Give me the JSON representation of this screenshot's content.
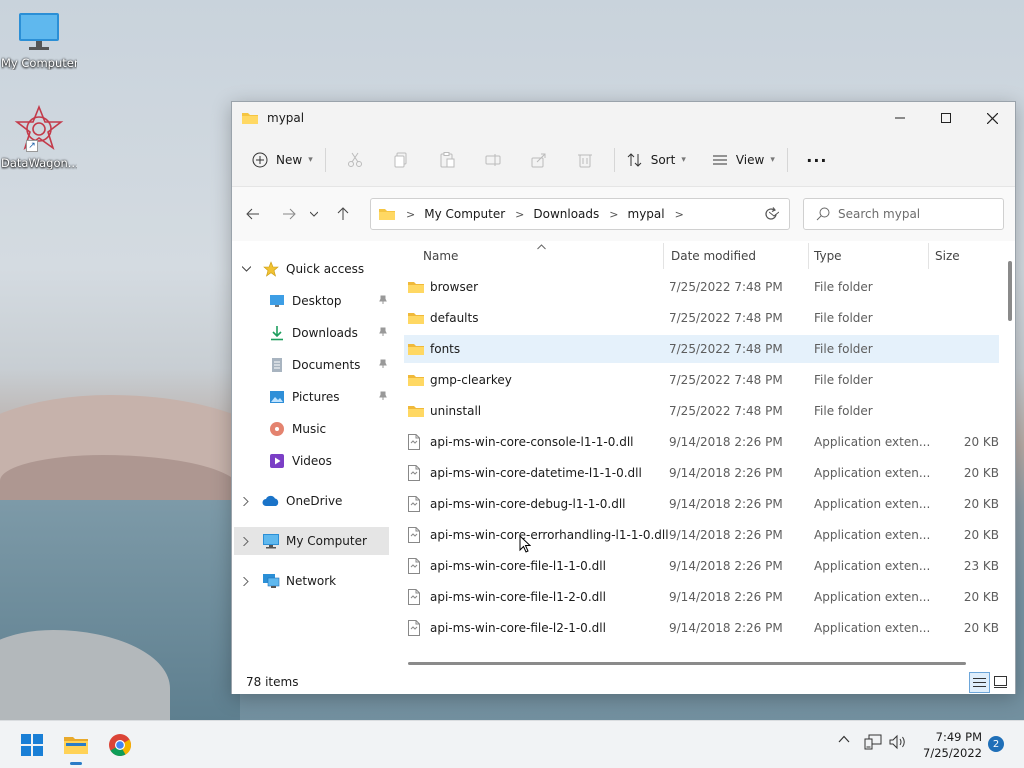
{
  "desktop": {
    "icons": [
      {
        "label": "My Computer"
      },
      {
        "label": "DataWagon..."
      }
    ]
  },
  "window": {
    "title": "mypal",
    "toolbar": {
      "new_label": "New",
      "sort_label": "Sort",
      "view_label": "View"
    },
    "address": {
      "crumbs": [
        "My Computer",
        "Downloads",
        "mypal"
      ]
    },
    "search": {
      "placeholder": "Search mypal"
    },
    "nav": {
      "quick_access": "Quick access",
      "items": [
        {
          "label": "Desktop",
          "icon": "desktop-icon",
          "pinned": true
        },
        {
          "label": "Downloads",
          "icon": "downloads-icon",
          "pinned": true
        },
        {
          "label": "Documents",
          "icon": "documents-icon",
          "pinned": true
        },
        {
          "label": "Pictures",
          "icon": "pictures-icon",
          "pinned": true
        },
        {
          "label": "Music",
          "icon": "music-icon",
          "pinned": false
        },
        {
          "label": "Videos",
          "icon": "videos-icon",
          "pinned": false
        }
      ],
      "onedrive": "OneDrive",
      "mycomputer": "My Computer",
      "network": "Network"
    },
    "columns": {
      "name": "Name",
      "date": "Date modified",
      "type": "Type",
      "size": "Size"
    },
    "files": [
      {
        "name": "browser",
        "date": "7/25/2022 7:48 PM",
        "type": "File folder",
        "size": "",
        "kind": "folder"
      },
      {
        "name": "defaults",
        "date": "7/25/2022 7:48 PM",
        "type": "File folder",
        "size": "",
        "kind": "folder"
      },
      {
        "name": "fonts",
        "date": "7/25/2022 7:48 PM",
        "type": "File folder",
        "size": "",
        "kind": "folder",
        "selected": true
      },
      {
        "name": "gmp-clearkey",
        "date": "7/25/2022 7:48 PM",
        "type": "File folder",
        "size": "",
        "kind": "folder"
      },
      {
        "name": "uninstall",
        "date": "7/25/2022 7:48 PM",
        "type": "File folder",
        "size": "",
        "kind": "folder"
      },
      {
        "name": "api-ms-win-core-console-l1-1-0.dll",
        "date": "9/14/2018 2:26 PM",
        "type": "Application exten...",
        "size": "20 KB",
        "kind": "dll"
      },
      {
        "name": "api-ms-win-core-datetime-l1-1-0.dll",
        "date": "9/14/2018 2:26 PM",
        "type": "Application exten...",
        "size": "20 KB",
        "kind": "dll"
      },
      {
        "name": "api-ms-win-core-debug-l1-1-0.dll",
        "date": "9/14/2018 2:26 PM",
        "type": "Application exten...",
        "size": "20 KB",
        "kind": "dll"
      },
      {
        "name": "api-ms-win-core-errorhandling-l1-1-0.dll",
        "date": "9/14/2018 2:26 PM",
        "type": "Application exten...",
        "size": "20 KB",
        "kind": "dll"
      },
      {
        "name": "api-ms-win-core-file-l1-1-0.dll",
        "date": "9/14/2018 2:26 PM",
        "type": "Application exten...",
        "size": "23 KB",
        "kind": "dll"
      },
      {
        "name": "api-ms-win-core-file-l1-2-0.dll",
        "date": "9/14/2018 2:26 PM",
        "type": "Application exten...",
        "size": "20 KB",
        "kind": "dll"
      },
      {
        "name": "api-ms-win-core-file-l2-1-0.dll",
        "date": "9/14/2018 2:26 PM",
        "type": "Application exten...",
        "size": "20 KB",
        "kind": "dll"
      }
    ],
    "status": {
      "item_count": "78 items"
    }
  },
  "taskbar": {
    "time": "7:49 PM",
    "date": "7/25/2022",
    "notification_count": "2"
  },
  "colors": {
    "folder": "#f5c542",
    "selection": "#e5f1fb",
    "accent": "#2a7cc7"
  }
}
